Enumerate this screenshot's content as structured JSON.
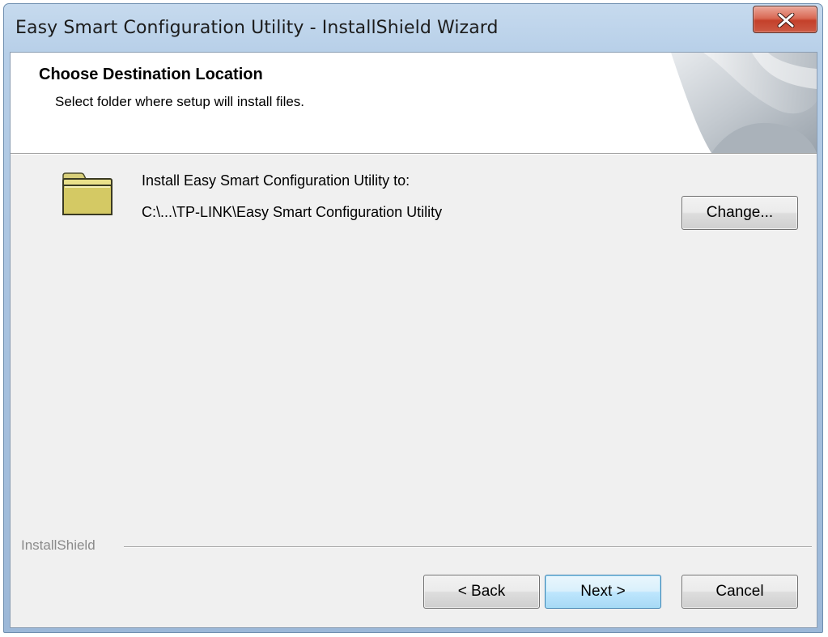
{
  "window": {
    "title": "Easy Smart Configuration Utility - InstallShield Wizard"
  },
  "header": {
    "title": "Choose Destination Location",
    "subtitle": "Select folder where setup will install files."
  },
  "destination": {
    "label": "Install Easy Smart Configuration Utility to:",
    "path": "C:\\...\\TP-LINK\\Easy Smart Configuration Utility",
    "change_label": "Change..."
  },
  "footer": {
    "brand": "InstallShield",
    "back_label": "< Back",
    "next_label": "Next >",
    "cancel_label": "Cancel"
  },
  "icons": {
    "close": "close-icon",
    "folder": "folder-icon"
  },
  "colors": {
    "titlebar": "#b7cfe8",
    "close_button": "#c4402a",
    "default_button_border": "#3c7fb1",
    "dialog_background": "#f0f0f0"
  }
}
